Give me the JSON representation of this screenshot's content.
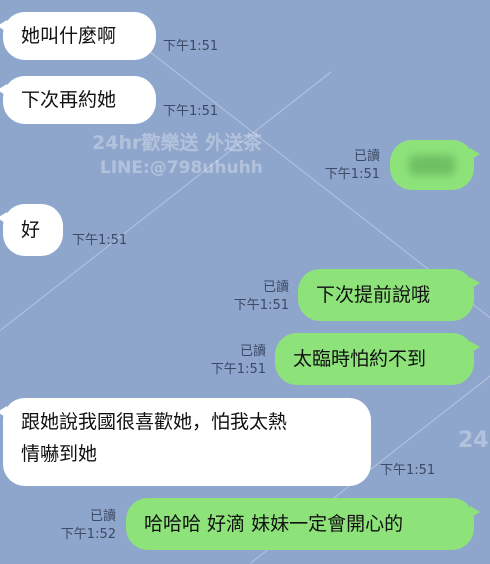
{
  "watermark": {
    "line1": "24hr歡樂送 外送茶",
    "line2": "LINE:@798uhuhh",
    "edge_text": "24"
  },
  "messages": [
    {
      "side": "in",
      "text": "她叫什麼啊",
      "time": "下午1:51"
    },
    {
      "side": "in",
      "text": "下次再約她",
      "time": "下午1:51"
    },
    {
      "side": "out",
      "text": "",
      "read": "已讀",
      "time": "下午1:51"
    },
    {
      "side": "in",
      "text": "好",
      "time": "下午1:51"
    },
    {
      "side": "out",
      "text": "下次提前說哦",
      "read": "已讀",
      "time": "下午1:51"
    },
    {
      "side": "out",
      "text": "太臨時怕約不到",
      "read": "已讀",
      "time": "下午1:51"
    },
    {
      "side": "in",
      "text": "跟她說我國很喜歡她，怕我太熱\n情嚇到她",
      "time": "下午1:51"
    },
    {
      "side": "out",
      "text": "哈哈哈 好滴 妹妹一定會開心的",
      "read": "已讀",
      "time": "下午1:52"
    }
  ],
  "colors": {
    "background": "#8fa6cc",
    "incoming": "#ffffff",
    "outgoing": "#8de27a"
  }
}
